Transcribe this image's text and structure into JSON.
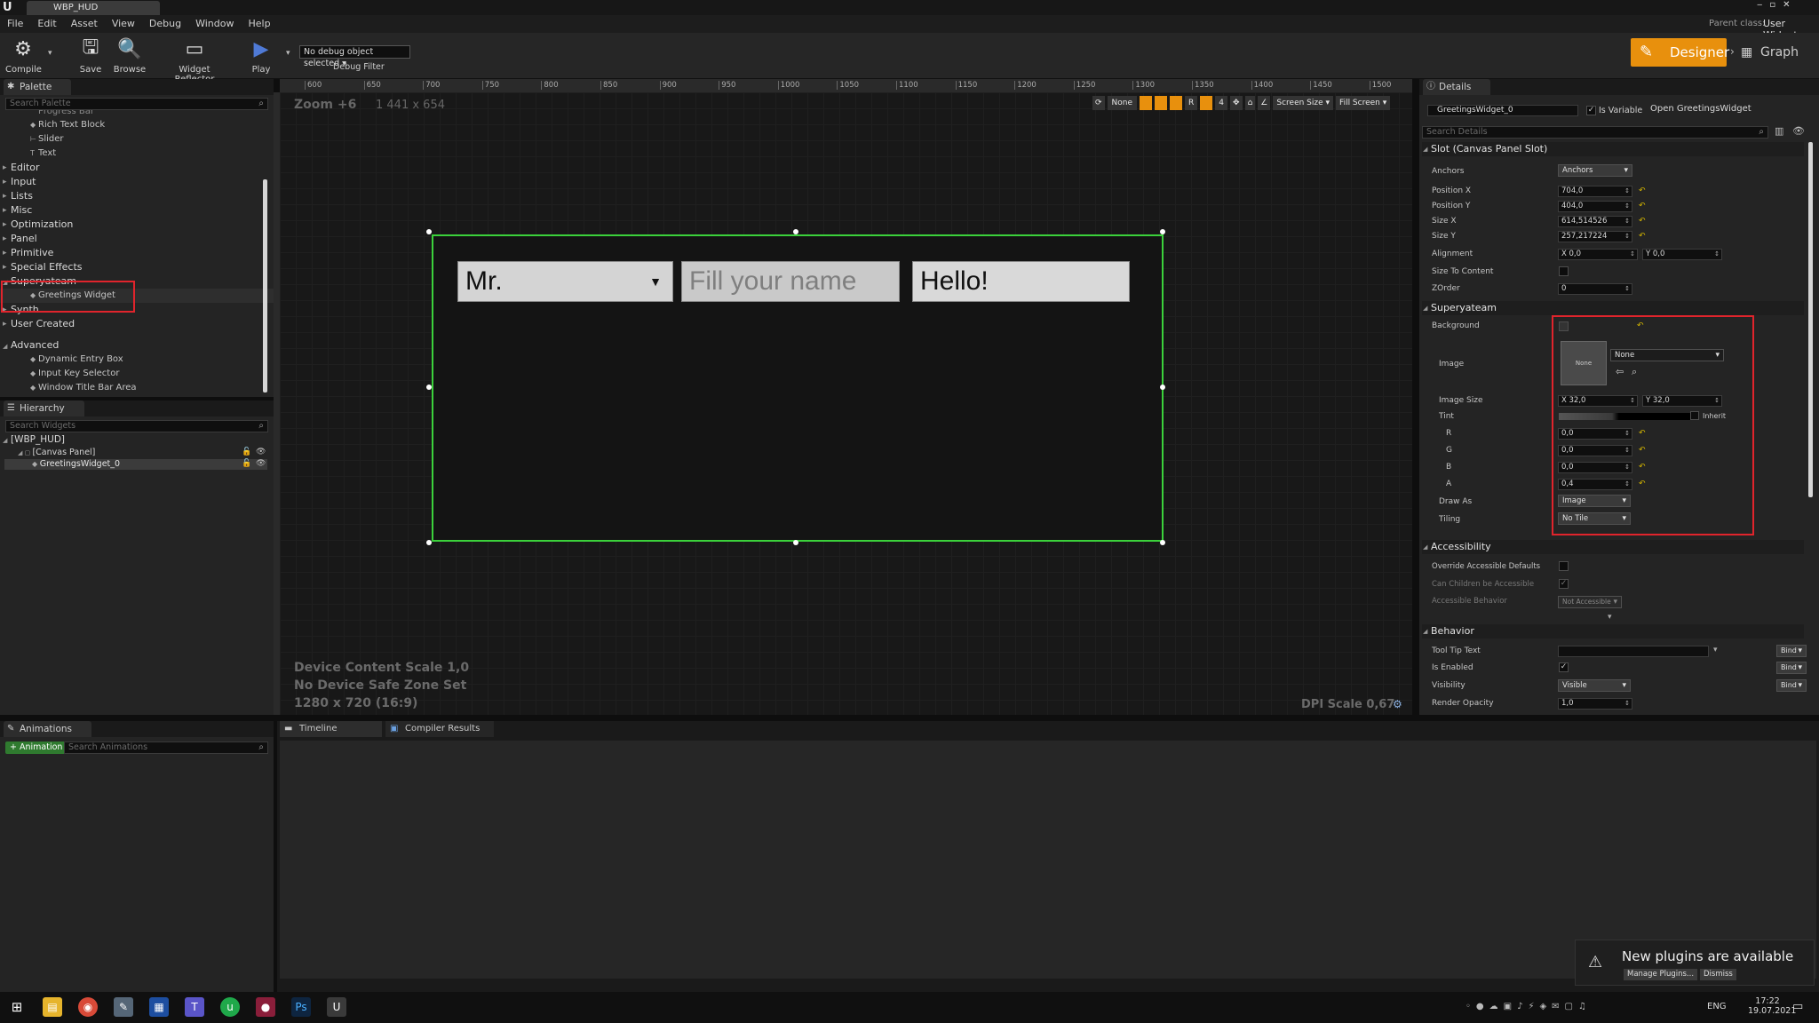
{
  "window": {
    "tab_title": "WBP_HUD",
    "parent_class_label": "Parent class:",
    "parent_class_value": "User Widget"
  },
  "menu": [
    "File",
    "Edit",
    "Asset",
    "View",
    "Debug",
    "Window",
    "Help"
  ],
  "toolbar": {
    "compile": "Compile",
    "save": "Save",
    "browse": "Browse",
    "widget_reflector": "Widget Reflector",
    "play": "Play",
    "debug_select": "No debug object selected",
    "debug_filter": "Debug Filter",
    "designer": "Designer",
    "graph": "Graph"
  },
  "palette": {
    "title": "Palette",
    "search_placeholder": "Search Palette",
    "top_items": [
      "Progress Bar",
      "Rich Text Block",
      "Slider",
      "Text"
    ],
    "categories": [
      "Editor",
      "Input",
      "Lists",
      "Misc",
      "Optimization",
      "Panel",
      "Primitive",
      "Special Effects"
    ],
    "superyateam": "Superyateam",
    "greetings_widget": "Greetings Widget",
    "categories2": [
      "Synth",
      "User Created"
    ],
    "advanced": "Advanced",
    "advanced_items": [
      "Dynamic Entry Box",
      "Input Key Selector",
      "Window Title Bar Area"
    ]
  },
  "hierarchy": {
    "title": "Hierarchy",
    "search_placeholder": "Search Widgets",
    "root": "[WBP_HUD]",
    "canvas": "[Canvas Panel]",
    "child": "GreetingsWidget_0"
  },
  "animations": {
    "title": "Animations",
    "add_button": "+ Animation",
    "search_placeholder": "Search Animations"
  },
  "bottom_tabs": {
    "timeline": "Timeline",
    "compiler": "Compiler Results"
  },
  "designer": {
    "zoom": "Zoom +6",
    "resolution": "1 441 x 654",
    "none_btn": "None",
    "r_btn": "R",
    "four_btn": "4",
    "screen_size": "Screen Size",
    "fill_screen": "Fill Screen",
    "content_scale": "Device Content Scale 1,0",
    "safe_zone": "No Device Safe Zone Set",
    "res_label": "1280 x 720 (16:9)",
    "dpi": "DPI Scale 0,67",
    "ruler_ticks": [
      "600",
      "650",
      "700",
      "750",
      "800",
      "850",
      "900",
      "950",
      "1000",
      "1050",
      "1100",
      "1150",
      "1200",
      "1250",
      "1300",
      "1350",
      "1400",
      "1450",
      "1500"
    ]
  },
  "widget": {
    "combo_value": "Mr.",
    "name_placeholder": "Fill your name",
    "button_label": "Hello!"
  },
  "details": {
    "title": "Details",
    "widget_name": "GreetingsWidget_0",
    "is_variable": "Is Variable",
    "open_btn": "Open GreetingsWidget",
    "search_placeholder": "Search Details",
    "slot_section": "Slot (Canvas Panel Slot)",
    "anchors_label": "Anchors",
    "anchors_value": "Anchors",
    "position_x_label": "Position X",
    "position_x": "704,0",
    "position_y_label": "Position Y",
    "position_y": "404,0",
    "size_x_label": "Size X",
    "size_x": "614,514526",
    "size_y_label": "Size Y",
    "size_y": "257,217224",
    "alignment_label": "Alignment",
    "alignment_x": "X 0,0",
    "alignment_y": "Y 0,0",
    "size_to_content": "Size To Content",
    "zorder_label": "ZOrder",
    "zorder": "0",
    "superyateam_section": "Superyateam",
    "background_label": "Background",
    "image_label": "Image",
    "image_none": "None",
    "image_dropdown": "None",
    "image_size_label": "Image Size",
    "image_size_x": "X 32,0",
    "image_size_y": "Y 32,0",
    "tint_label": "Tint",
    "inherit": "Inherit",
    "r_label": "R",
    "r": "0,0",
    "g_label": "G",
    "g": "0,0",
    "b_label": "B",
    "b": "0,0",
    "a_label": "A",
    "a": "0,4",
    "draw_as_label": "Draw As",
    "draw_as": "Image",
    "tiling_label": "Tiling",
    "tiling": "No Tile",
    "accessibility_section": "Accessibility",
    "override_accessible": "Override Accessible Defaults",
    "children_accessible": "Can Children be Accessible",
    "accessible_behavior": "Accessible Behavior",
    "not_accessible": "Not Accessible",
    "behavior_section": "Behavior",
    "tooltip_label": "Tool Tip Text",
    "bind": "Bind",
    "is_enabled": "Is Enabled",
    "visibility_label": "Visibility",
    "visibility": "Visible",
    "render_opacity_label": "Render Opacity",
    "render_opacity": "1,0"
  },
  "notification": {
    "title": "New plugins are available",
    "manage": "Manage Plugins...",
    "dismiss": "Dismiss"
  },
  "taskbar": {
    "lang": "ENG",
    "time": "17:22",
    "date": "19.07.2021"
  },
  "colors": {
    "accent_orange": "#e8900d",
    "selection_green": "#3bd13b",
    "highlight_red": "#e0242c"
  }
}
